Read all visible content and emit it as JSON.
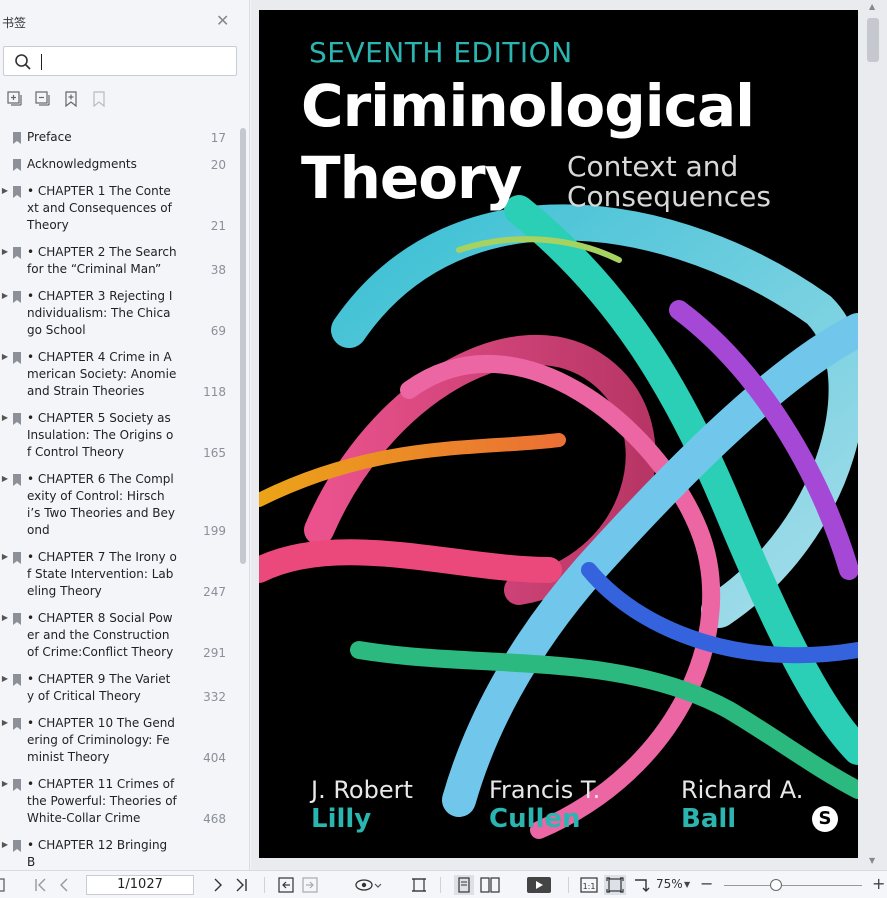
{
  "sidebar": {
    "title": "书签",
    "search": {
      "value": "",
      "placeholder": ""
    },
    "bookmarks": [
      {
        "label": "Preface",
        "page": "17",
        "expandable": false
      },
      {
        "label": "Acknowledgments",
        "page": "20",
        "expandable": false
      },
      {
        "label": "• CHAPTER 1 The Context and Consequences of Theory",
        "page": "21",
        "expandable": true
      },
      {
        "label": "• CHAPTER 2 The Search for the “Criminal Man”",
        "page": "38",
        "expandable": true
      },
      {
        "label": "• CHAPTER 3 Rejecting Individualism: The Chicago School",
        "page": "69",
        "expandable": true
      },
      {
        "label": "• CHAPTER 4 Crime in American Society: Anomie and Strain Theories",
        "page": "118",
        "expandable": true
      },
      {
        "label": "• CHAPTER 5 Society as Insulation: The Origins of Control Theory",
        "page": "165",
        "expandable": true
      },
      {
        "label": "• CHAPTER 6 The Complexity of Control: Hirschi’s Two Theories and Beyond",
        "page": "199",
        "expandable": true
      },
      {
        "label": "• CHAPTER 7 The Irony of State Intervention: Labeling Theory",
        "page": "247",
        "expandable": true
      },
      {
        "label": "• CHAPTER 8 Social Power and the Construction of Crime:Conflict Theory",
        "page": "291",
        "expandable": true
      },
      {
        "label": "• CHAPTER 9 The Variety of Critical Theory",
        "page": "332",
        "expandable": true
      },
      {
        "label": "• CHAPTER 10 The Gendering of Criminology: Feminist Theory",
        "page": "404",
        "expandable": true
      },
      {
        "label": "• CHAPTER 11 Crimes of the Powerful: Theories of White-Collar Crime",
        "page": "468",
        "expandable": true
      },
      {
        "label": "• CHAPTER 12 Bringing B",
        "page": "",
        "expandable": true
      }
    ]
  },
  "cover": {
    "edition": "SEVENTH EDITION",
    "title_line1": "Criminological",
    "title_line2": "Theory",
    "subtitle_line1": "Context and",
    "subtitle_line2": "Consequences",
    "authors": [
      {
        "first": "J. Robert",
        "last": "Lilly"
      },
      {
        "first": "Francis T.",
        "last": "Cullen"
      },
      {
        "first": "Richard A.",
        "last": "Ball"
      }
    ],
    "publisher_logo_letter": "S",
    "accent_color": "#2bb5b0"
  },
  "statusbar": {
    "page_display": "1/1027",
    "zoom": "75%",
    "zoom_fraction": 0.38
  }
}
